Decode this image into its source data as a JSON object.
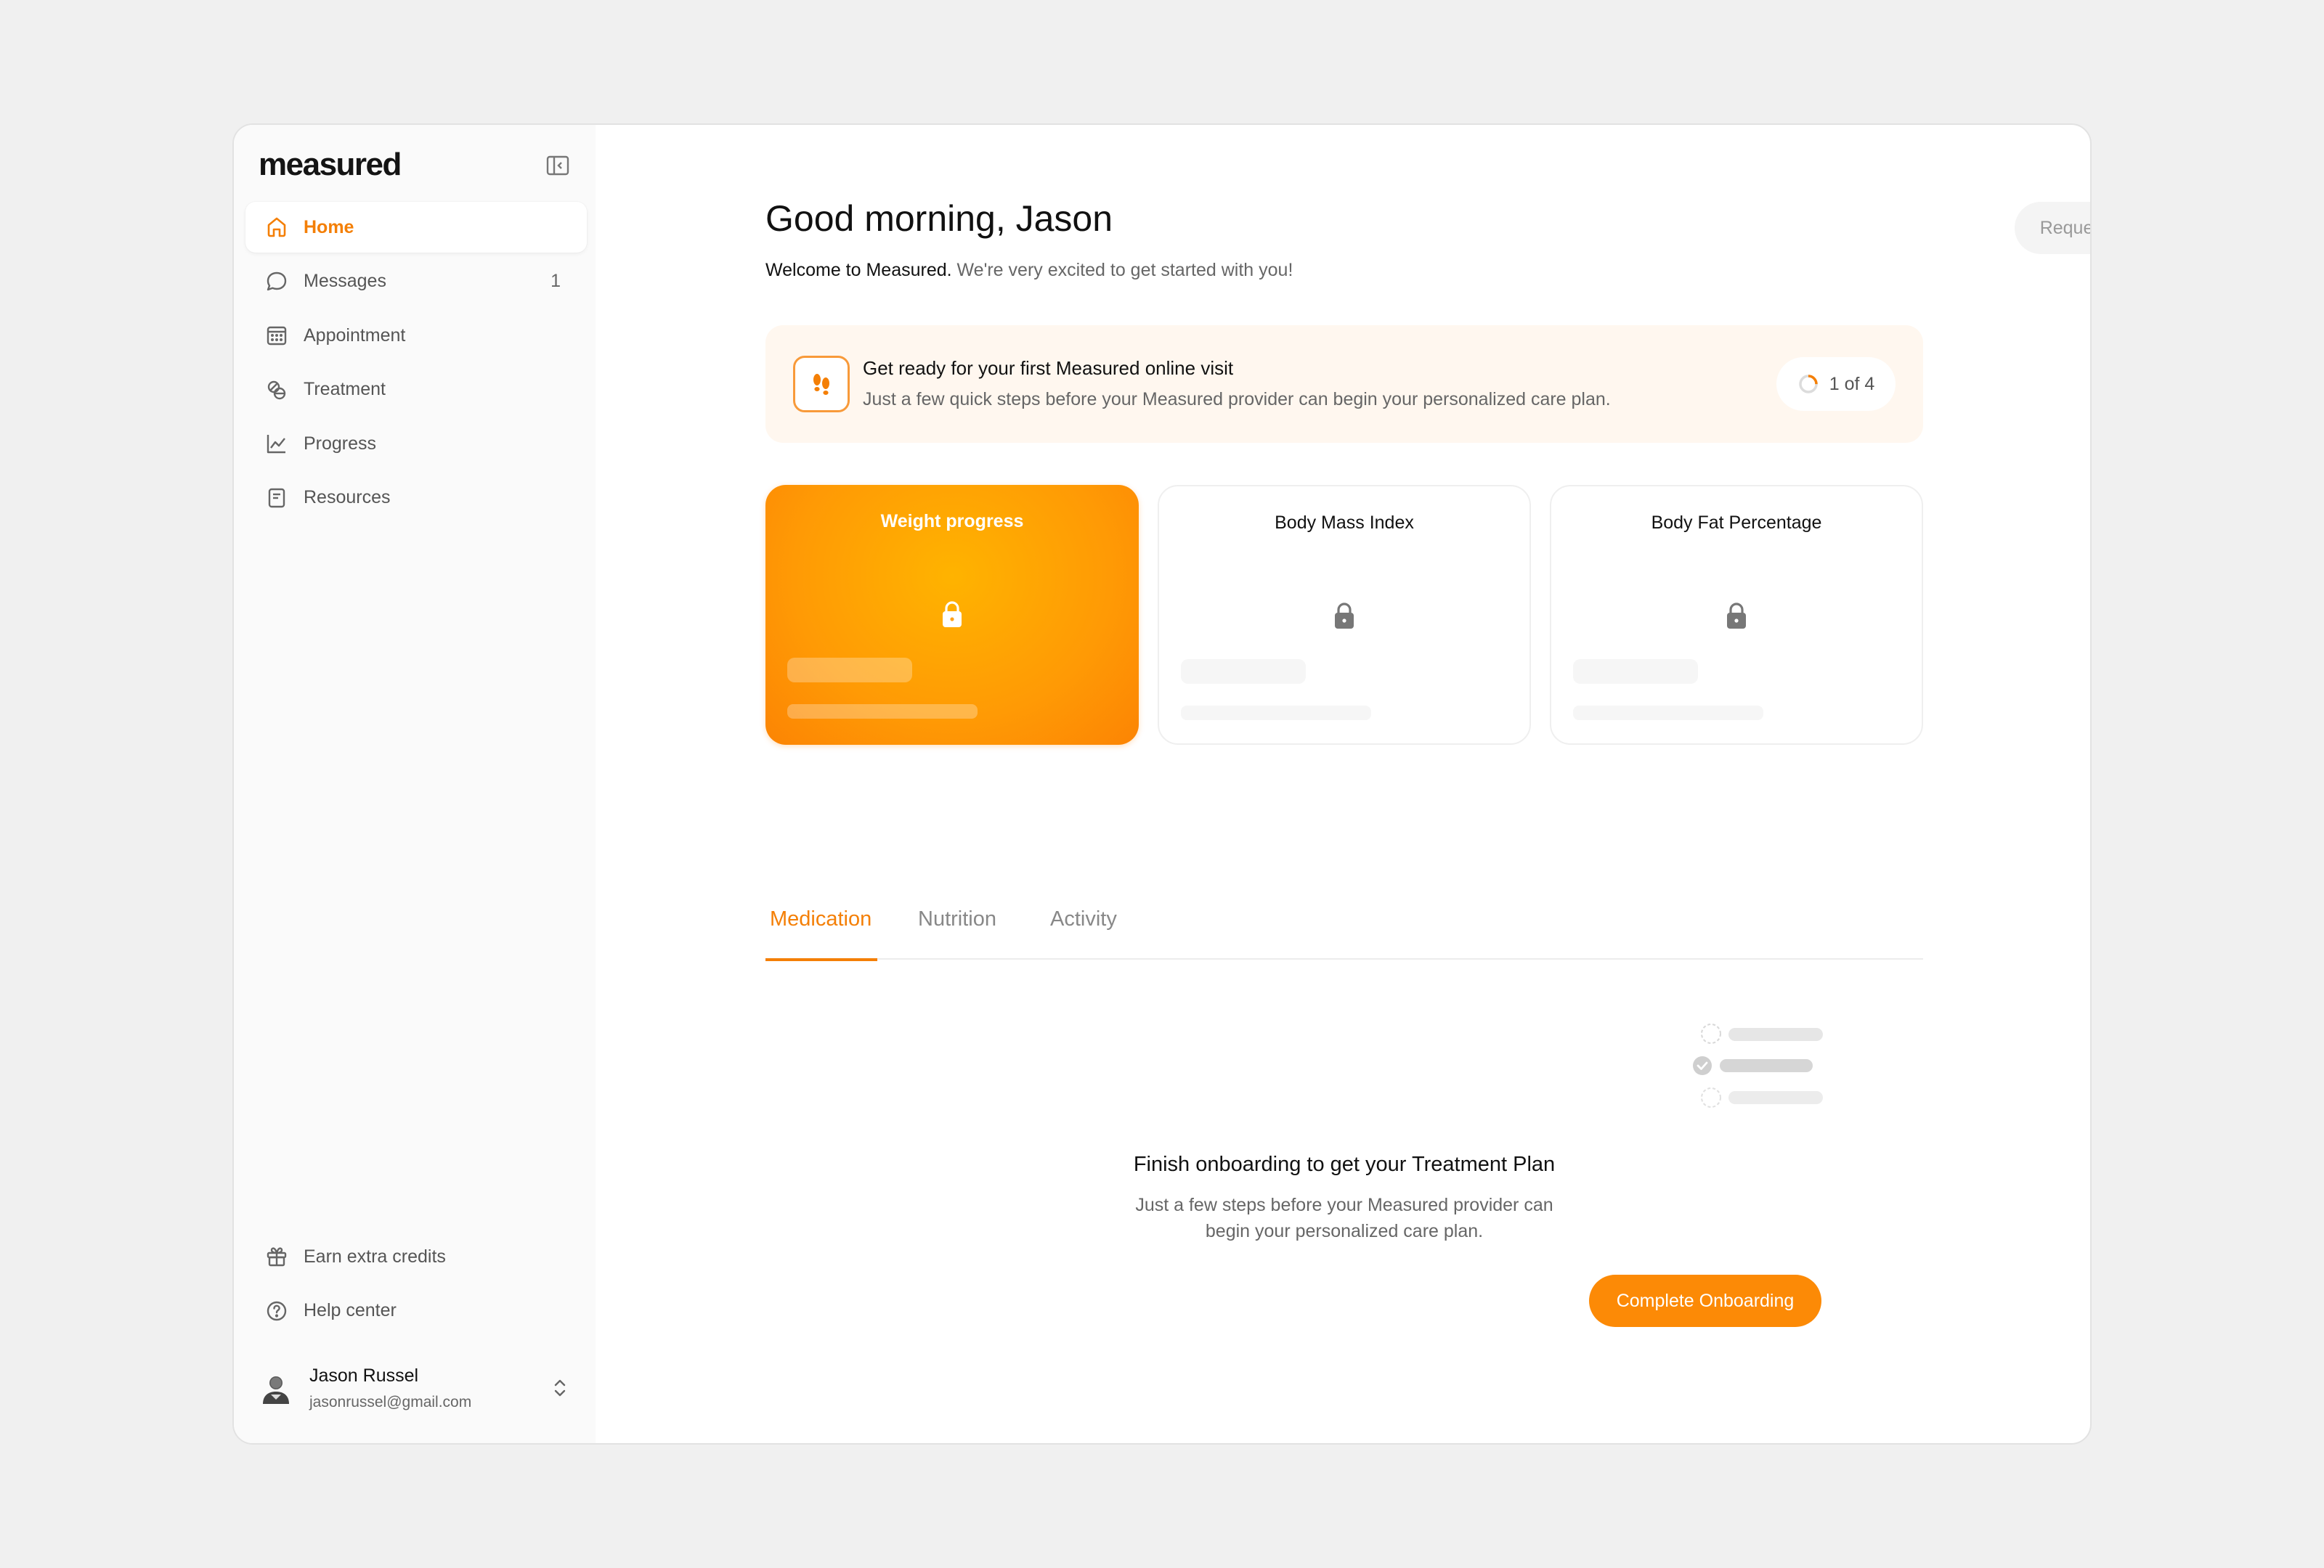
{
  "app": {
    "logo": "measured"
  },
  "sidebar": {
    "items": [
      {
        "label": "Home",
        "icon": "home-icon"
      },
      {
        "label": "Messages",
        "icon": "chat-bubble-icon",
        "count": "1"
      },
      {
        "label": "Appointment",
        "icon": "calendar-icon"
      },
      {
        "label": "Treatment",
        "icon": "pills-icon"
      },
      {
        "label": "Progress",
        "icon": "line-chart-icon"
      },
      {
        "label": "Resources",
        "icon": "document-icon"
      }
    ],
    "bottom_items": [
      {
        "label": "Earn extra credits",
        "icon": "gift-icon"
      },
      {
        "label": "Help center",
        "icon": "help-circle-icon"
      }
    ],
    "user": {
      "name": "Jason Russel",
      "email": "jasonrussel@gmail.com"
    }
  },
  "header": {
    "greeting": "Good morning, Jason",
    "welcome_strong": "Welcome to Measured.",
    "welcome_rest": " We're very excited to get started with you!",
    "request_button": "Request Treatment"
  },
  "banner": {
    "title": "Get ready for your first Measured online visit",
    "subtitle": "Just a few quick steps before your Measured provider can begin your personalized care plan.",
    "progress_text": "1 of 4",
    "progress_fraction": 0.25
  },
  "cards": [
    {
      "title": "Weight progress"
    },
    {
      "title": "Body Mass Index"
    },
    {
      "title": "Body Fat Percentage"
    }
  ],
  "tabs": [
    {
      "label": "Medication"
    },
    {
      "label": "Nutrition"
    },
    {
      "label": "Activity"
    }
  ],
  "empty_state": {
    "title": "Finish onboarding to get your Treatment Plan",
    "line1": "Just a few steps before your Measured provider can",
    "line2": "begin your personalized care plan.",
    "cta": "Complete Onboarding"
  },
  "colors": {
    "accent": "#f47f06",
    "banner_bg": "#fff7ef",
    "card_active": "#ff9a05"
  }
}
